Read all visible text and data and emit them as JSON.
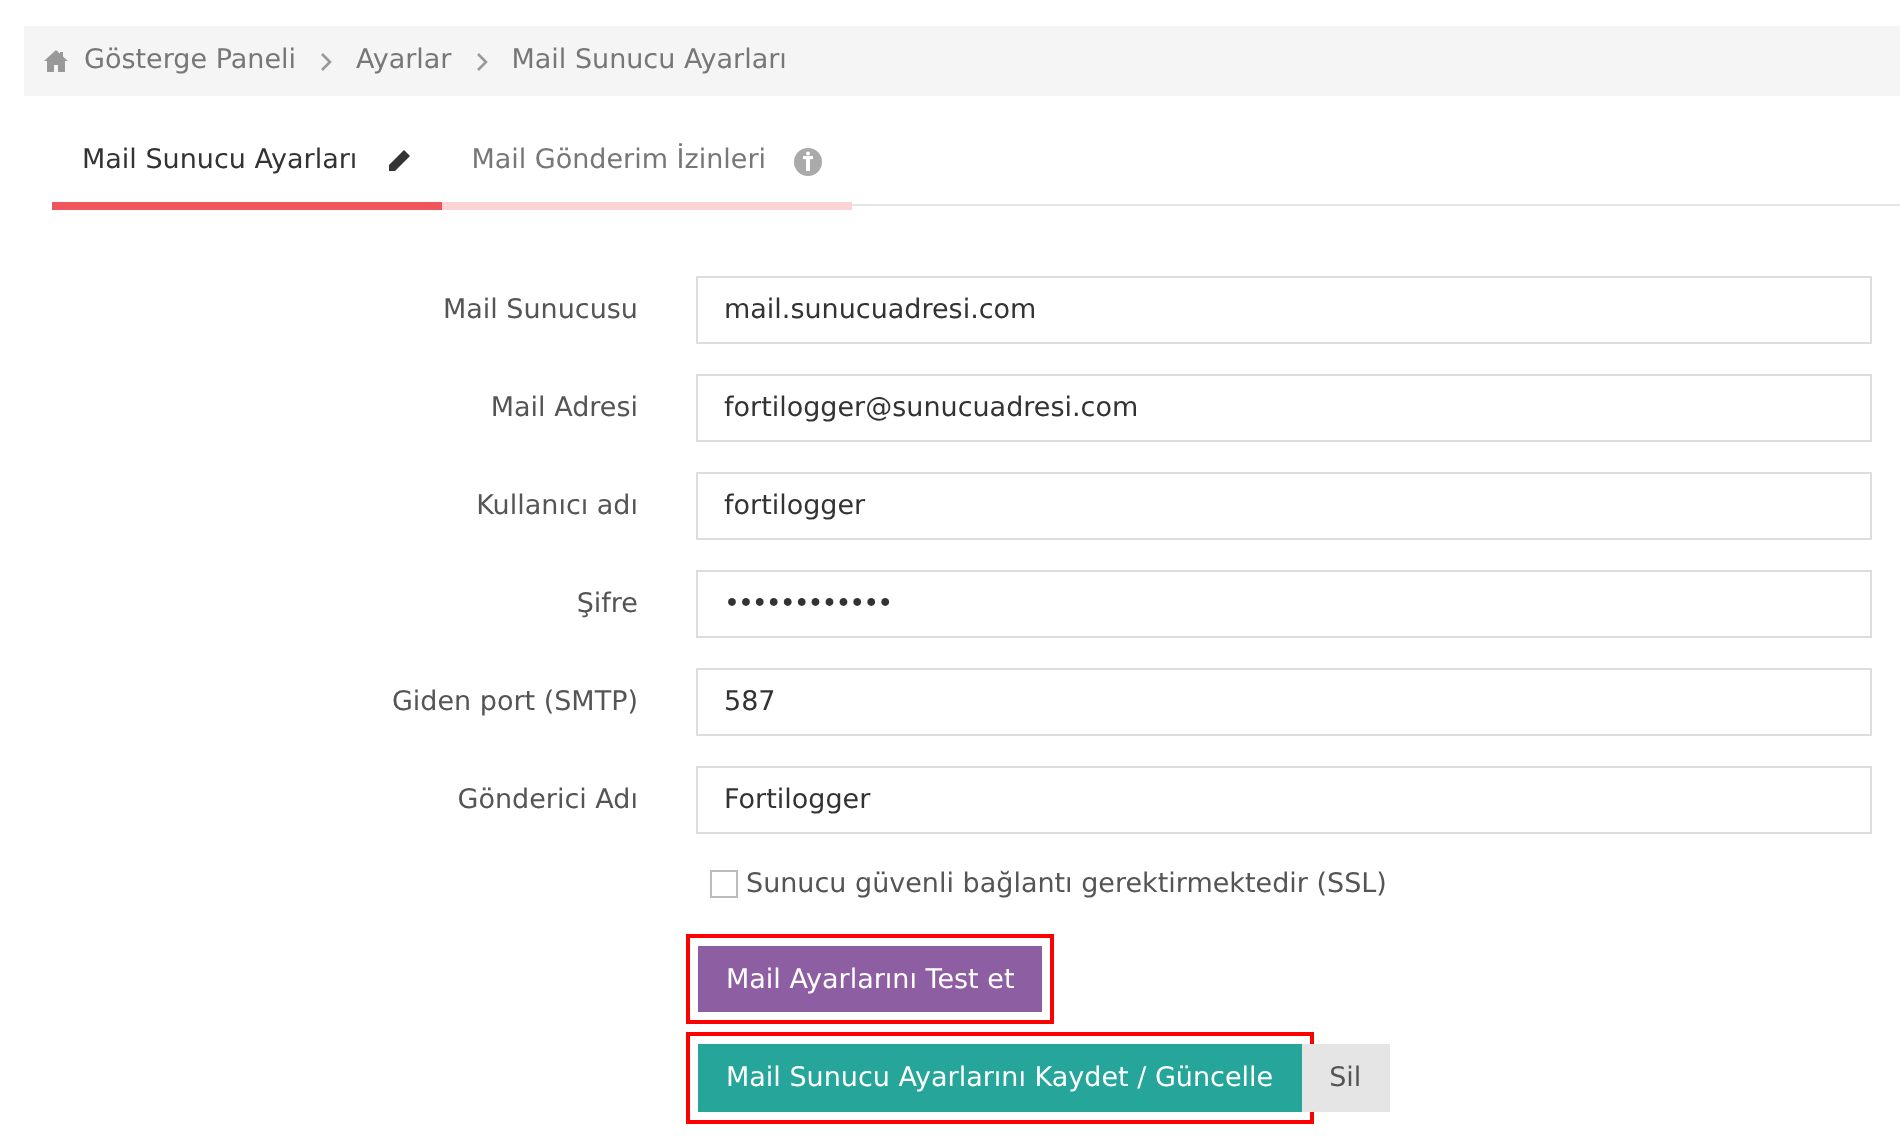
{
  "breadcrumb": [
    {
      "label": "Gösterge Paneli"
    },
    {
      "label": "Ayarlar"
    },
    {
      "label": "Mail Sunucu Ayarları"
    }
  ],
  "tabs": [
    {
      "label": "Mail Sunucu Ayarları",
      "selected": true,
      "kind": "edit"
    },
    {
      "label": "Mail Gönderim İzinleri",
      "selected": false,
      "kind": "info"
    }
  ],
  "fields": [
    {
      "label": "Mail Sunucusu",
      "value": "mail.sunucuadresi.com",
      "kind": "text"
    },
    {
      "label": "Mail Adresi",
      "value": "fortilogger@sunucuadresi.com",
      "kind": "text"
    },
    {
      "label": "Kullanıcı adı",
      "value": "fortilogger",
      "kind": "text"
    },
    {
      "label": "Şifre",
      "value": "••••••••••••",
      "kind": "password"
    },
    {
      "label": "Giden port (SMTP)",
      "value": "587",
      "kind": "text"
    },
    {
      "label": "Gönderici Adı",
      "value": "Fortilogger",
      "kind": "text"
    }
  ],
  "ssl_checkbox": {
    "label": "Sunucu güvenli bağlantı gerektirmektedir (SSL)",
    "checked": false
  },
  "test_button": {
    "label": "Mail Ayarlarını Test et",
    "highlighted": true
  },
  "save_button": {
    "label": "Mail Sunucu Ayarlarını Kaydet / Güncelle",
    "highlighted": true
  },
  "delete_button": {
    "label": "Sil"
  }
}
